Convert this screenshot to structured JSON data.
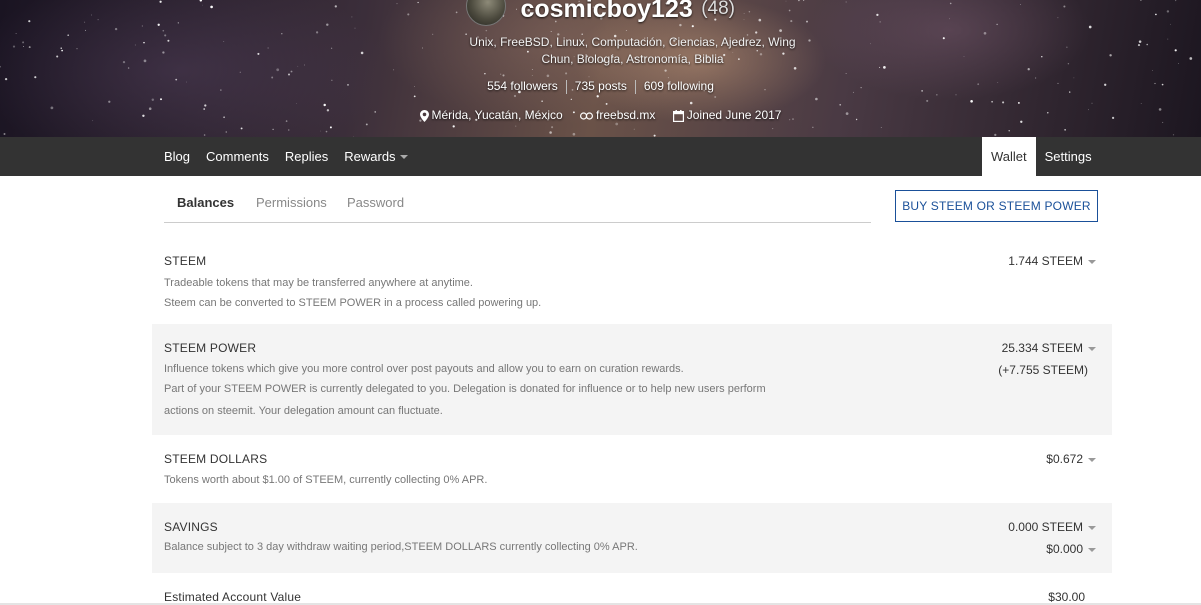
{
  "profile": {
    "username": "cosmicboy123",
    "reputation": "(48)",
    "about_line1": "Unix, FreeBSD, Linux, Computación, Ciencias, Ajedrez, Wing",
    "about_line2": "Chun, Biología, Astronomía, Biblia",
    "followers": "554 followers",
    "posts": "735 posts",
    "following": "609 following",
    "location": "Mérida, Yucatán, México",
    "website": "freebsd.mx",
    "joined": "Joined June 2017"
  },
  "nav": {
    "left": [
      "Blog",
      "Comments",
      "Replies",
      "Rewards"
    ],
    "wallet": "Wallet",
    "settings": "Settings"
  },
  "tabs": {
    "balances": "Balances",
    "permissions": "Permissions",
    "password": "Password"
  },
  "buy_button": "BUY STEEM OR STEEM POWER",
  "balances": {
    "steem": {
      "name": "STEEM",
      "desc1": "Tradeable tokens that may be transferred anywhere at anytime.",
      "desc2": "Steem can be converted to STEEM POWER in a process called powering up.",
      "amount": "1.744 STEEM"
    },
    "steem_power": {
      "name": "STEEM POWER",
      "desc1": "Influence tokens which give you more control over post payouts and allow you to earn on curation rewards.",
      "desc2": "Part of your STEEM POWER is currently delegated to you. Delegation is donated for influence or to help new users perform",
      "desc3": "actions on steemit. Your delegation amount can fluctuate.",
      "amount": "25.334 STEEM",
      "delegated": "(+7.755 STEEM)"
    },
    "steem_dollars": {
      "name": "STEEM DOLLARS",
      "desc1": "Tokens worth about $1.00 of STEEM, currently collecting 0% APR.",
      "amount": "$0.672"
    },
    "savings": {
      "name": "SAVINGS",
      "desc1": "Balance subject to 3 day withdraw waiting period,STEEM DOLLARS currently collecting 0% APR.",
      "amount_steem": "0.000 STEEM",
      "amount_sbd": "$0.000"
    },
    "estimated": {
      "name": "Estimated Account Value",
      "amount": "$30.00"
    }
  }
}
